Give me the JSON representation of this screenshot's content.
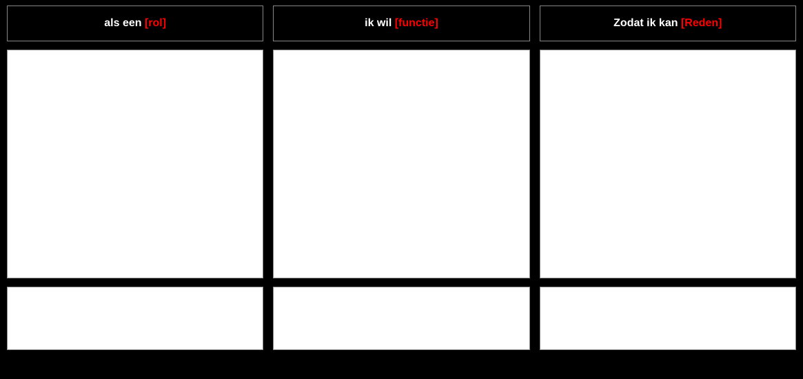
{
  "headers": [
    {
      "prefix": "als een ",
      "bracket": "[rol]"
    },
    {
      "prefix": "ik wil ",
      "bracket": "[functie]"
    },
    {
      "prefix": "Zodat ik kan ",
      "bracket": "[Reden]"
    }
  ]
}
